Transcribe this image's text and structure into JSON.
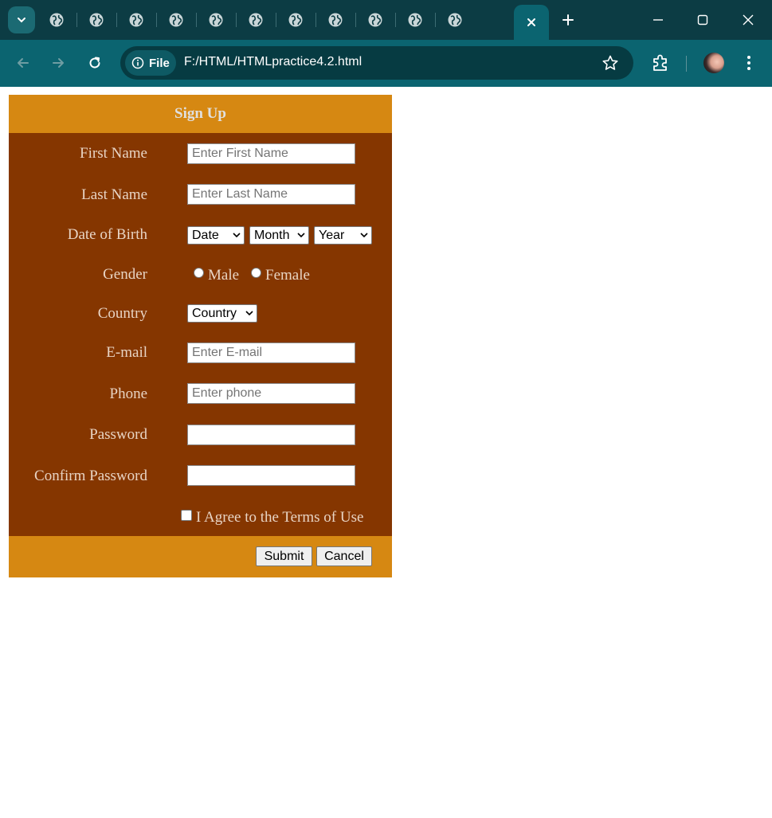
{
  "browser": {
    "tab_count_inactive": 11,
    "address_chip_label": "File",
    "url": "F:/HTML/HTMLpractice4.2.html",
    "colors": {
      "tabstrip": "#0c3c44",
      "toolbar": "#0b6470",
      "omnibox": "#063b42"
    }
  },
  "form": {
    "title": "Sign Up",
    "colors": {
      "header": "#d68812",
      "body": "#853600",
      "label_text": "#e8d4c4"
    },
    "first_name": {
      "label": "First Name",
      "placeholder": "Enter First Name"
    },
    "last_name": {
      "label": "Last Name",
      "placeholder": "Enter Last Name"
    },
    "dob": {
      "label": "Date of Birth",
      "date": "Date",
      "month": "Month",
      "year": "Year"
    },
    "gender": {
      "label": "Gender",
      "male": "Male",
      "female": "Female"
    },
    "country": {
      "label": "Country",
      "selected": "Country"
    },
    "email": {
      "label": "E-mail",
      "placeholder": "Enter E-mail"
    },
    "phone": {
      "label": "Phone",
      "placeholder": "Enter phone"
    },
    "password": {
      "label": "Password"
    },
    "confirm_password": {
      "label": "Confirm Password"
    },
    "terms": "I Agree to the Terms of Use",
    "submit": "Submit",
    "cancel": "Cancel"
  }
}
